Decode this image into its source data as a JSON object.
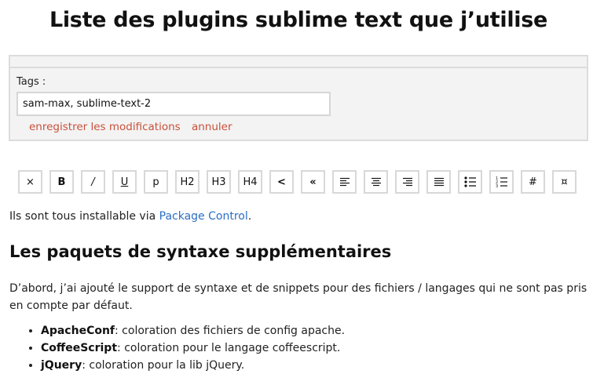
{
  "page": {
    "title": "Liste des plugins sublime text que j’utilise"
  },
  "editor": {
    "tags_label": "Tags :",
    "tags_value": "sam-max, sublime-text-2",
    "save_link": "enregistrer les modifications",
    "cancel_link": "annuler"
  },
  "toolbar": {
    "buttons": [
      {
        "name": "close",
        "glyph": "×"
      },
      {
        "name": "bold",
        "glyph": "B"
      },
      {
        "name": "italic",
        "glyph": "/"
      },
      {
        "name": "underline",
        "glyph": "U"
      },
      {
        "name": "paragraph",
        "glyph": "p"
      },
      {
        "name": "h2",
        "glyph": "H2"
      },
      {
        "name": "h3",
        "glyph": "H3"
      },
      {
        "name": "h4",
        "glyph": "H4"
      },
      {
        "name": "code",
        "glyph": "<"
      },
      {
        "name": "quote",
        "glyph": "«"
      },
      {
        "name": "align-left",
        "glyph": ""
      },
      {
        "name": "align-center",
        "glyph": ""
      },
      {
        "name": "align-right",
        "glyph": ""
      },
      {
        "name": "align-justify",
        "glyph": ""
      },
      {
        "name": "bullet-list",
        "glyph": ""
      },
      {
        "name": "numbered-list",
        "glyph": ""
      },
      {
        "name": "hash",
        "glyph": "#"
      },
      {
        "name": "special-char",
        "glyph": "¤"
      }
    ]
  },
  "content": {
    "intro_text": "Ils sont tous installable via ",
    "intro_link": "Package Control",
    "intro_end": ".",
    "section_title": "Les paquets de syntaxe supplémentaires",
    "paragraph": "D’abord, j’ai ajouté le support de syntaxe et de snippets pour des fichiers / langages qui ne sont pas pris en compte par défaut.",
    "list": [
      {
        "name": "ApacheConf",
        "desc": ": coloration des fichiers de config apache."
      },
      {
        "name": "CoffeeScript",
        "desc": ": coloration pour le langage coffeescript."
      },
      {
        "name": "jQuery",
        "desc": ": coloration pour la lib jQuery."
      }
    ]
  }
}
